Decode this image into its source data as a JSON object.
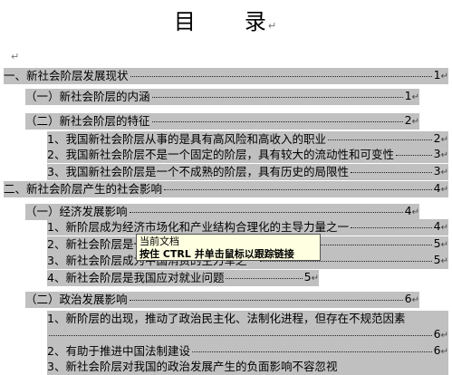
{
  "title": "目　　录",
  "pilcrow": "↵",
  "entries": [
    {
      "text": "一、新社会阶层发展现状",
      "page": "1"
    },
    {
      "text": "（一）新社会阶层的内涵",
      "page": "1"
    },
    {
      "text": "（二）新社会阶层的特征",
      "page": "2"
    },
    {
      "text": "1、我国新社会阶层从事的是具有高风险和高收入的职业",
      "page": "2"
    },
    {
      "text": "2、我国新社会阶层不是一个固定的阶层，具有较大的流动性和可变性",
      "page": "3"
    },
    {
      "text": "3、我国新社会阶层是一个不成熟的阶层，具有历史的局限性",
      "page": "3"
    },
    {
      "text": "二、新社会阶层产生的社会影响",
      "page": "4"
    },
    {
      "text": "（一）经济发展影响",
      "page": "4"
    },
    {
      "text": "1、新阶层成为经济市场化和产业结构合理化的主导力量之一",
      "page": "4"
    },
    {
      "text": "2、新社会阶层是一支重要的经济力量",
      "page": "5"
    },
    {
      "text": "3、新社会阶层成为中国消费的主力军之一",
      "page": "5"
    },
    {
      "text": "4、新社会阶层是我国应对就业问题",
      "page": "5"
    },
    {
      "text": "（二）政治发展影响",
      "page": "6"
    },
    {
      "text": "1、新阶层的出现，推动了政治民主化、法制化进程，但存在不规范因素",
      "page": ""
    },
    {
      "text": "",
      "page": "6"
    },
    {
      "text": "2、有助于推进中国法制建设",
      "page": "6"
    },
    {
      "text": "3、新社会阶层对我国的政治发展产生的负面影响不容忽视",
      "page": ""
    }
  ],
  "tooltip": {
    "line1": "当前文档",
    "line2": "按住 CTRL 并单击鼠标以跟踪链接"
  }
}
